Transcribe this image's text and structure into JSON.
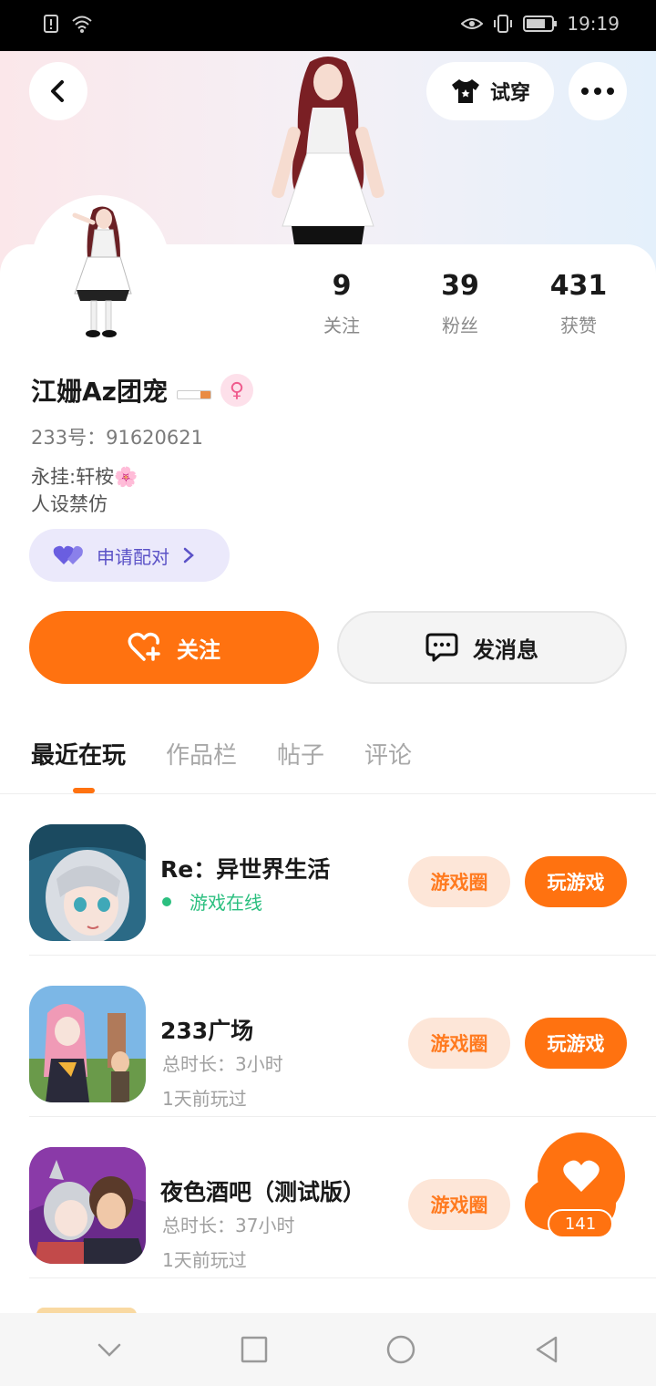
{
  "status_bar": {
    "time": "19:19"
  },
  "header": {
    "try_on_label": "试穿"
  },
  "profile": {
    "nickname": "江姗Az团宠",
    "uid_label": "233号：",
    "uid_value": "91620621",
    "bio_lines": [
      "永挂:轩桉🌸",
      "人设禁仿"
    ],
    "pair_label": "申请配对",
    "stats": [
      {
        "value": "9",
        "label": "关注"
      },
      {
        "value": "39",
        "label": "粉丝"
      },
      {
        "value": "431",
        "label": "获赞"
      }
    ]
  },
  "actions": {
    "follow_label": "关注",
    "message_label": "发消息"
  },
  "tabs": [
    "最近在玩",
    "作品栏",
    "帖子",
    "评论"
  ],
  "games": [
    {
      "title": "Re：异世界生活",
      "status": "游戏在线",
      "circle_label": "游戏圈",
      "play_label": "玩游戏"
    },
    {
      "title": "233广场",
      "duration": "总时长：3小时",
      "last_played": "1天前玩过",
      "circle_label": "游戏圈",
      "play_label": "玩游戏"
    },
    {
      "title": "夜色酒吧（测试版）",
      "duration": "总时长：37小时",
      "last_played": "1天前玩过",
      "circle_label": "游戏圈"
    }
  ],
  "like": {
    "count": "141"
  },
  "colors": {
    "accent": "#ff7210",
    "online": "#2bbf7f",
    "pair": "#5b52c7"
  }
}
